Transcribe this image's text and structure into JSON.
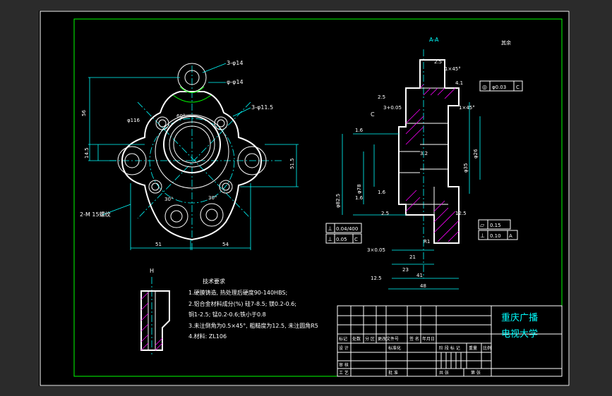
{
  "section_label": "A-A",
  "view_label": "H",
  "roughness_note": "其余",
  "notes_title": "技术要求",
  "notes": [
    "1.硬膜铸造, 热处理后硬度90-140HBS;",
    "2.铝合金材料成分(%) 硅7-8.5; 镁0.2-0.6;",
    "  铜1-2.5; 锰0.2-0.6;铁小于0.8",
    "3.未注倒角为0.5×45°, 粗糙度为12.5, 未注圆角R5",
    "4.材料: ZL106"
  ],
  "front_view_labels": {
    "hole_top": "3-φ14",
    "hole_top2": "φ-φ14",
    "hole_thread": "3-φ11.5",
    "hole_left": "2-M 15螺纹",
    "dia_center": "φ116",
    "dim_left_1": "56",
    "dim_left_2": "14.5",
    "dim_right": "51.5",
    "dim_bottom_left": "51",
    "dim_bottom_right": "54",
    "angle_1": "60°",
    "angle_2": "30°",
    "angle_3": "30°"
  },
  "section_view_labels": {
    "dim_top_1": "2.5",
    "dim_top_2": "1×45°",
    "dim_top_3": "4.1",
    "dim_left_1": "2.5",
    "dim_left_2": "3+0.05",
    "dim_left_3": "3×0.05",
    "dim_c": "C",
    "dim_1": "1.6",
    "dim_2": "3.2",
    "dim_3": "1.6",
    "dim_4": "1.6",
    "dim_5": "2.5",
    "dim_6": "12.5",
    "dim_7": "R1",
    "dim_8": "21",
    "dim_9": "23",
    "dim_10": "41",
    "dim_11": "48",
    "dim_12": "12.5",
    "dia_1": "φ82.5",
    "dia_2": "φ78",
    "dia_3": "φ35",
    "dia_4": "φ26",
    "chamfer": "1×45°"
  },
  "tolerance_frames": [
    {
      "symbol": "◎",
      "value": "φ0.03",
      "datum": "C"
    },
    {
      "symbol": "⊥",
      "value": "0.04/400",
      "datum": ""
    },
    {
      "symbol": "⊥",
      "value": "0.05",
      "datum": "C"
    },
    {
      "symbol": "▱",
      "value": "0.15",
      "datum": ""
    },
    {
      "symbol": "⊥",
      "value": "0.10",
      "datum": "A"
    }
  ],
  "title_block": {
    "school_line1": "重庆广播",
    "school_line2": "电视大学",
    "headers": [
      "标记",
      "处数",
      "分 区",
      "更改文件号",
      "签 名",
      "年月日"
    ],
    "row_design": "设 计",
    "row_std": "标准化",
    "row_review": "审 核",
    "row_process": "工 艺",
    "row_approve": "批 准",
    "stage_labels": [
      "阶 段 标 记",
      "重量",
      "比例"
    ],
    "sheet_total": "共  张",
    "sheet_no": "第  张"
  }
}
